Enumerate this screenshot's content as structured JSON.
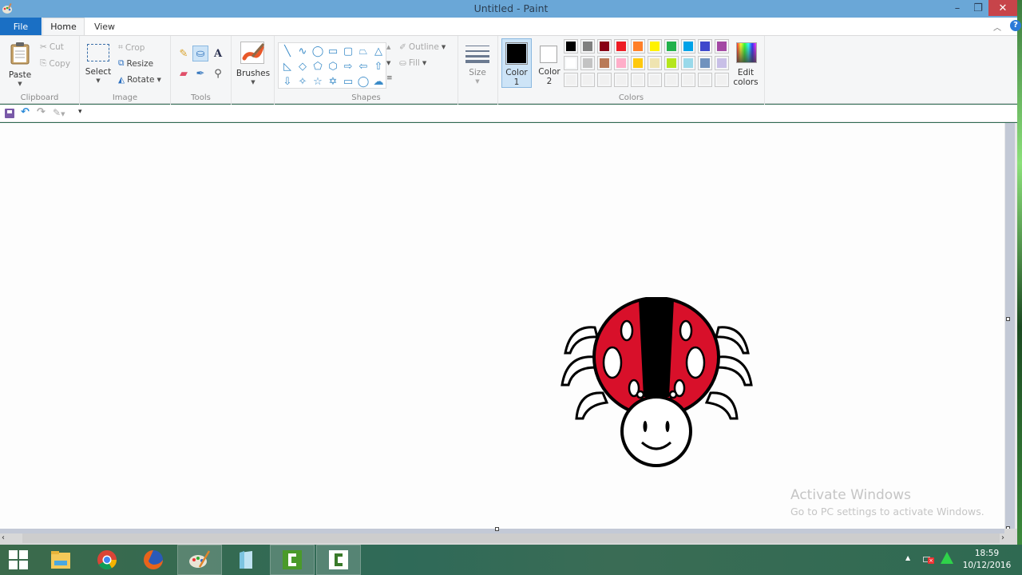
{
  "window": {
    "title": "Untitled - Paint",
    "controls": {
      "minimize": "–",
      "maximize": "❐",
      "close": "✕"
    },
    "help": "?"
  },
  "tabs": [
    {
      "label": "File",
      "active": false
    },
    {
      "label": "Home",
      "active": true
    },
    {
      "label": "View",
      "active": false
    }
  ],
  "ribbon": {
    "clipboard": {
      "label": "Clipboard",
      "paste": "Paste",
      "cut": "Cut",
      "copy": "Copy"
    },
    "image": {
      "label": "Image",
      "select": "Select",
      "crop": "Crop",
      "resize": "Resize",
      "rotate": "Rotate"
    },
    "tools": {
      "label": "Tools",
      "items": [
        "pencil",
        "fill",
        "text",
        "eraser",
        "color-picker",
        "magnifier"
      ],
      "selected": "fill"
    },
    "brushes": {
      "label": "Brushes"
    },
    "shapes": {
      "label": "Shapes",
      "outline": "Outline",
      "fill": "Fill",
      "items": [
        "line",
        "curve",
        "oval",
        "rectangle",
        "rounded-rectangle",
        "polygon",
        "triangle",
        "right-triangle",
        "diamond",
        "pentagon",
        "hexagon",
        "right-arrow",
        "left-arrow",
        "up-arrow",
        "down-arrow",
        "four-point-star",
        "five-point-star",
        "six-point-star",
        "rounded-callout",
        "oval-callout",
        "cloud-callout"
      ],
      "glyphs": [
        "╲",
        "∿",
        "◯",
        "▭",
        "▢",
        "⏢",
        "△",
        "◺",
        "◇",
        "⬠",
        "⬡",
        "⇨",
        "⇦",
        "⇧",
        "⇩",
        "✧",
        "☆",
        "✡",
        "▭",
        "◯",
        "☁"
      ]
    },
    "size": {
      "label": "Size"
    },
    "colors": {
      "label": "Colors",
      "color1_label": "Color",
      "color1_num": "1",
      "color2_label": "Color",
      "color2_num": "2",
      "color1": "#000000",
      "color2": "#ffffff",
      "edit_label": "Edit",
      "edit_label2": "colors",
      "palette_row1": [
        "#000000",
        "#7f7f7f",
        "#880015",
        "#ed1c24",
        "#ff7f27",
        "#fff200",
        "#22b14c",
        "#00a2e8",
        "#3f48cc",
        "#a349a4"
      ],
      "palette_row2": [
        "#ffffff",
        "#c3c3c3",
        "#b97a57",
        "#ffaec9",
        "#ffc90e",
        "#efe4b0",
        "#b5e61d",
        "#99d9ea",
        "#7092be",
        "#c8bfe7"
      ],
      "palette_row3": [
        "#f0f0f0",
        "#f0f0f0",
        "#f0f0f0",
        "#f0f0f0",
        "#f0f0f0",
        "#f0f0f0",
        "#f0f0f0",
        "#f0f0f0",
        "#f0f0f0",
        "#f0f0f0"
      ]
    }
  },
  "quick_access": [
    "save",
    "undo",
    "redo",
    "customize"
  ],
  "canvas": {
    "drawing": "ladybug",
    "colors": {
      "body": "#d8102a",
      "outline": "#000000",
      "spots": "#ffffff"
    }
  },
  "watermark": {
    "line1": "Activate Windows",
    "line2": "Go to PC settings to activate Windows."
  },
  "taskbar": {
    "items": [
      "start",
      "file-explorer",
      "chrome",
      "firefox",
      "paint",
      "notepad",
      "camtasia-recorder",
      "camtasia-studio"
    ],
    "active": "paint",
    "tray_expand": "▲",
    "time": "18:59",
    "date": "10/12/2016"
  }
}
